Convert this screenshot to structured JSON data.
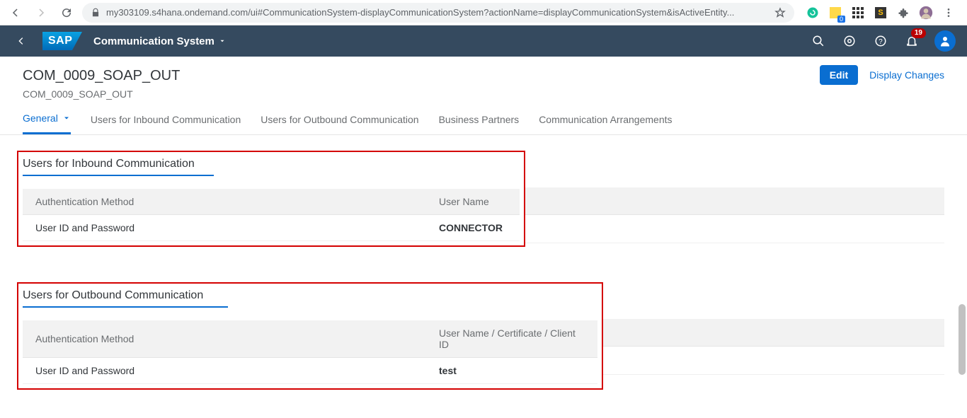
{
  "browser": {
    "url_display": "my303109.s4hana.ondemand.com/ui#CommunicationSystem-displayCommunicationSystem?actionName=displayCommunicationSystem&isActiveEntity...",
    "badge_ext": "0"
  },
  "shell": {
    "app_title": "Communication System",
    "notification_count": "19"
  },
  "header": {
    "title": "COM_0009_SOAP_OUT",
    "subtitle": "COM_0009_SOAP_OUT",
    "edit_label": "Edit",
    "display_changes_label": "Display Changes"
  },
  "tabs": [
    {
      "label": "General",
      "active": true,
      "has_chevron": true
    },
    {
      "label": "Users for Inbound Communication",
      "active": false
    },
    {
      "label": "Users for Outbound Communication",
      "active": false
    },
    {
      "label": "Business Partners",
      "active": false
    },
    {
      "label": "Communication Arrangements",
      "active": false
    }
  ],
  "inbound_section": {
    "title": "Users for Inbound Communication",
    "columns": [
      "Authentication Method",
      "User Name"
    ],
    "rows": [
      {
        "auth": "User ID and Password",
        "user": "CONNECTOR"
      }
    ]
  },
  "outbound_section": {
    "title": "Users for Outbound Communication",
    "columns": [
      "Authentication Method",
      "User Name / Certificate / Client ID"
    ],
    "rows": [
      {
        "auth": "User ID and Password",
        "user": "test"
      }
    ]
  }
}
